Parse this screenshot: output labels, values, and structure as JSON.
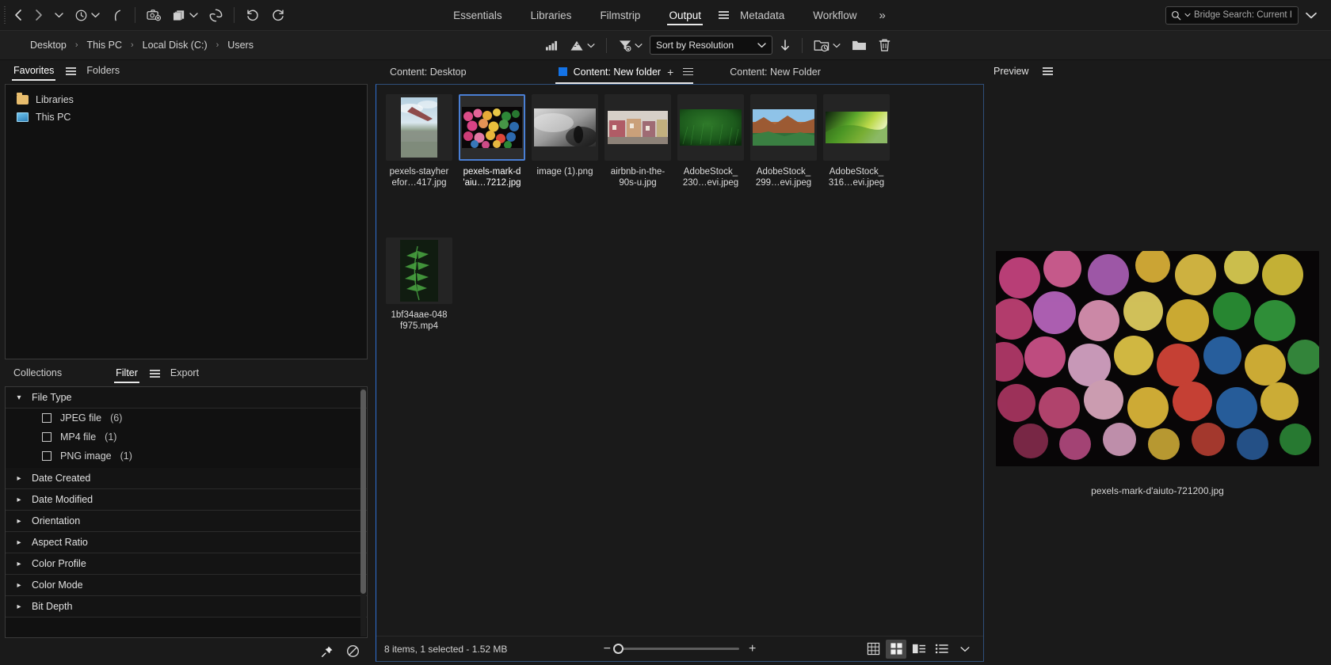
{
  "app": {
    "title": "Adobe Bridge",
    "accent": "#1473e6"
  },
  "topbar": {
    "nav": {
      "back_icon": "chevron-left-icon",
      "forward_icon": "chevron-right-icon",
      "dropdown_icon": "chevron-down-icon",
      "recent_icon": "clock-history-icon",
      "recent_dropdown_icon": "chevron-down-icon",
      "reveal_icon": "parent-folder-icon"
    },
    "tools": {
      "camera_icon": "get-photos-from-camera-icon",
      "stack_icon": "new-window-icon",
      "stack_dropdown_icon": "chevron-down-icon",
      "refine_icon": "refine-aperture-icon",
      "rotate_ccw_icon": "rotate-counterclockwise-icon",
      "rotate_cw_icon": "rotate-clockwise-icon"
    },
    "tabs": [
      {
        "label": "Essentials",
        "active": false
      },
      {
        "label": "Libraries",
        "active": false
      },
      {
        "label": "Filmstrip",
        "active": false
      },
      {
        "label": "Output",
        "active": true
      },
      {
        "label": "Metadata",
        "active": false
      },
      {
        "label": "Workflow",
        "active": false
      }
    ],
    "workspace_menu_icon": "hamburger-icon",
    "more_label": "»",
    "search": {
      "icon": "search-icon",
      "dropdown_icon": "chevron-down-icon",
      "value": "Bridge Search: Current I"
    },
    "window_caret_icon": "chevron-down-icon"
  },
  "pathbar": {
    "breadcrumbs": [
      "Desktop",
      "This PC",
      "Local Disk (C:)",
      "Users"
    ],
    "separator": "›",
    "tools": {
      "filter_rating_icon": "filter-rating-icon",
      "filter_rating_menu_icon": "filter-rating-dropdown-icon",
      "filter_funnel_icon": "filter-funnel-icon",
      "sort_label": "Sort by Resolution",
      "sort_direction_icon": "sort-descending-icon",
      "recent_folder_icon": "recent-folder-icon",
      "new_folder_icon": "new-folder-icon",
      "delete_icon": "trash-icon"
    }
  },
  "sidebar": {
    "top_tabs": [
      {
        "label": "Favorites",
        "active": true,
        "menu_icon": "hamburger-icon"
      },
      {
        "label": "Folders",
        "active": false
      }
    ],
    "favorites": [
      {
        "label": "Libraries",
        "icon": "folder-icon"
      },
      {
        "label": "This PC",
        "icon": "computer-icon"
      }
    ],
    "bottom_tabs": [
      {
        "label": "Collections",
        "active": false
      },
      {
        "label": "Filter",
        "active": true,
        "menu_icon": "hamburger-icon"
      },
      {
        "label": "Export",
        "active": false
      }
    ],
    "filter_groups": [
      {
        "label": "File Type",
        "expanded": true,
        "options": [
          {
            "label": "JPEG file",
            "count": "(6)",
            "checked": false
          },
          {
            "label": "MP4 file",
            "count": "(1)",
            "checked": false
          },
          {
            "label": "PNG image",
            "count": "(1)",
            "checked": false
          }
        ]
      },
      {
        "label": "Date Created",
        "expanded": false,
        "options": []
      },
      {
        "label": "Date Modified",
        "expanded": false,
        "options": []
      },
      {
        "label": "Orientation",
        "expanded": false,
        "options": []
      },
      {
        "label": "Aspect Ratio",
        "expanded": false,
        "options": []
      },
      {
        "label": "Color Profile",
        "expanded": false,
        "options": []
      },
      {
        "label": "Color Mode",
        "expanded": false,
        "options": []
      },
      {
        "label": "Bit Depth",
        "expanded": false,
        "options": []
      }
    ],
    "footer": {
      "pin_icon": "pin-icon",
      "clear_filter_icon": "clear-filter-icon"
    }
  },
  "content": {
    "tabs": [
      {
        "label": "Content: Desktop",
        "active": false,
        "marker": false
      },
      {
        "label": "Content: New folder",
        "active": true,
        "marker": true
      },
      {
        "label": "Content: New Folder",
        "active": false,
        "marker": false
      }
    ],
    "tab_add_icon": "plus-icon",
    "tab_menu_icon": "hamburger-icon",
    "items": [
      {
        "name_line1": "pexels-stayher",
        "name_line2": "efor…417.jpg",
        "selected": false,
        "kind": "photo-plane"
      },
      {
        "name_line1": "pexels-mark-d",
        "name_line2": "'aiu…7212.jpg",
        "selected": true,
        "kind": "photo-bokeh"
      },
      {
        "name_line1": "image (1).png",
        "name_line2": "",
        "selected": false,
        "kind": "photo-fog"
      },
      {
        "name_line1": "airbnb-in-the-",
        "name_line2": "90s-u.jpg",
        "selected": false,
        "kind": "photo-street"
      },
      {
        "name_line1": "AdobeStock_",
        "name_line2": "230…evi.jpeg",
        "selected": false,
        "kind": "photo-grass"
      },
      {
        "name_line1": "AdobeStock_",
        "name_line2": "299…evi.jpeg",
        "selected": false,
        "kind": "photo-canyon"
      },
      {
        "name_line1": "AdobeStock_",
        "name_line2": "316…evi.jpeg",
        "selected": false,
        "kind": "photo-leaf-green"
      },
      {
        "name_line1": "1bf34aae-048",
        "name_line2": "f975.mp4",
        "selected": false,
        "kind": "video-fern"
      }
    ],
    "status": "8 items, 1 selected - 1.52 MB",
    "zoom": {
      "minus_label": "−",
      "plus_label": "+",
      "slider_position_pct": 8
    },
    "view_modes": [
      {
        "icon": "grid-view-icon",
        "active": false
      },
      {
        "icon": "thumbnail-view-icon",
        "active": true
      },
      {
        "icon": "details-view-icon",
        "active": false
      },
      {
        "icon": "list-view-icon",
        "active": false
      },
      {
        "icon": "chevron-down-icon",
        "active": false
      }
    ]
  },
  "preview": {
    "title": "Preview",
    "menu_icon": "hamburger-icon",
    "caption": "pexels-mark-d'aiuto-721200.jpg"
  }
}
